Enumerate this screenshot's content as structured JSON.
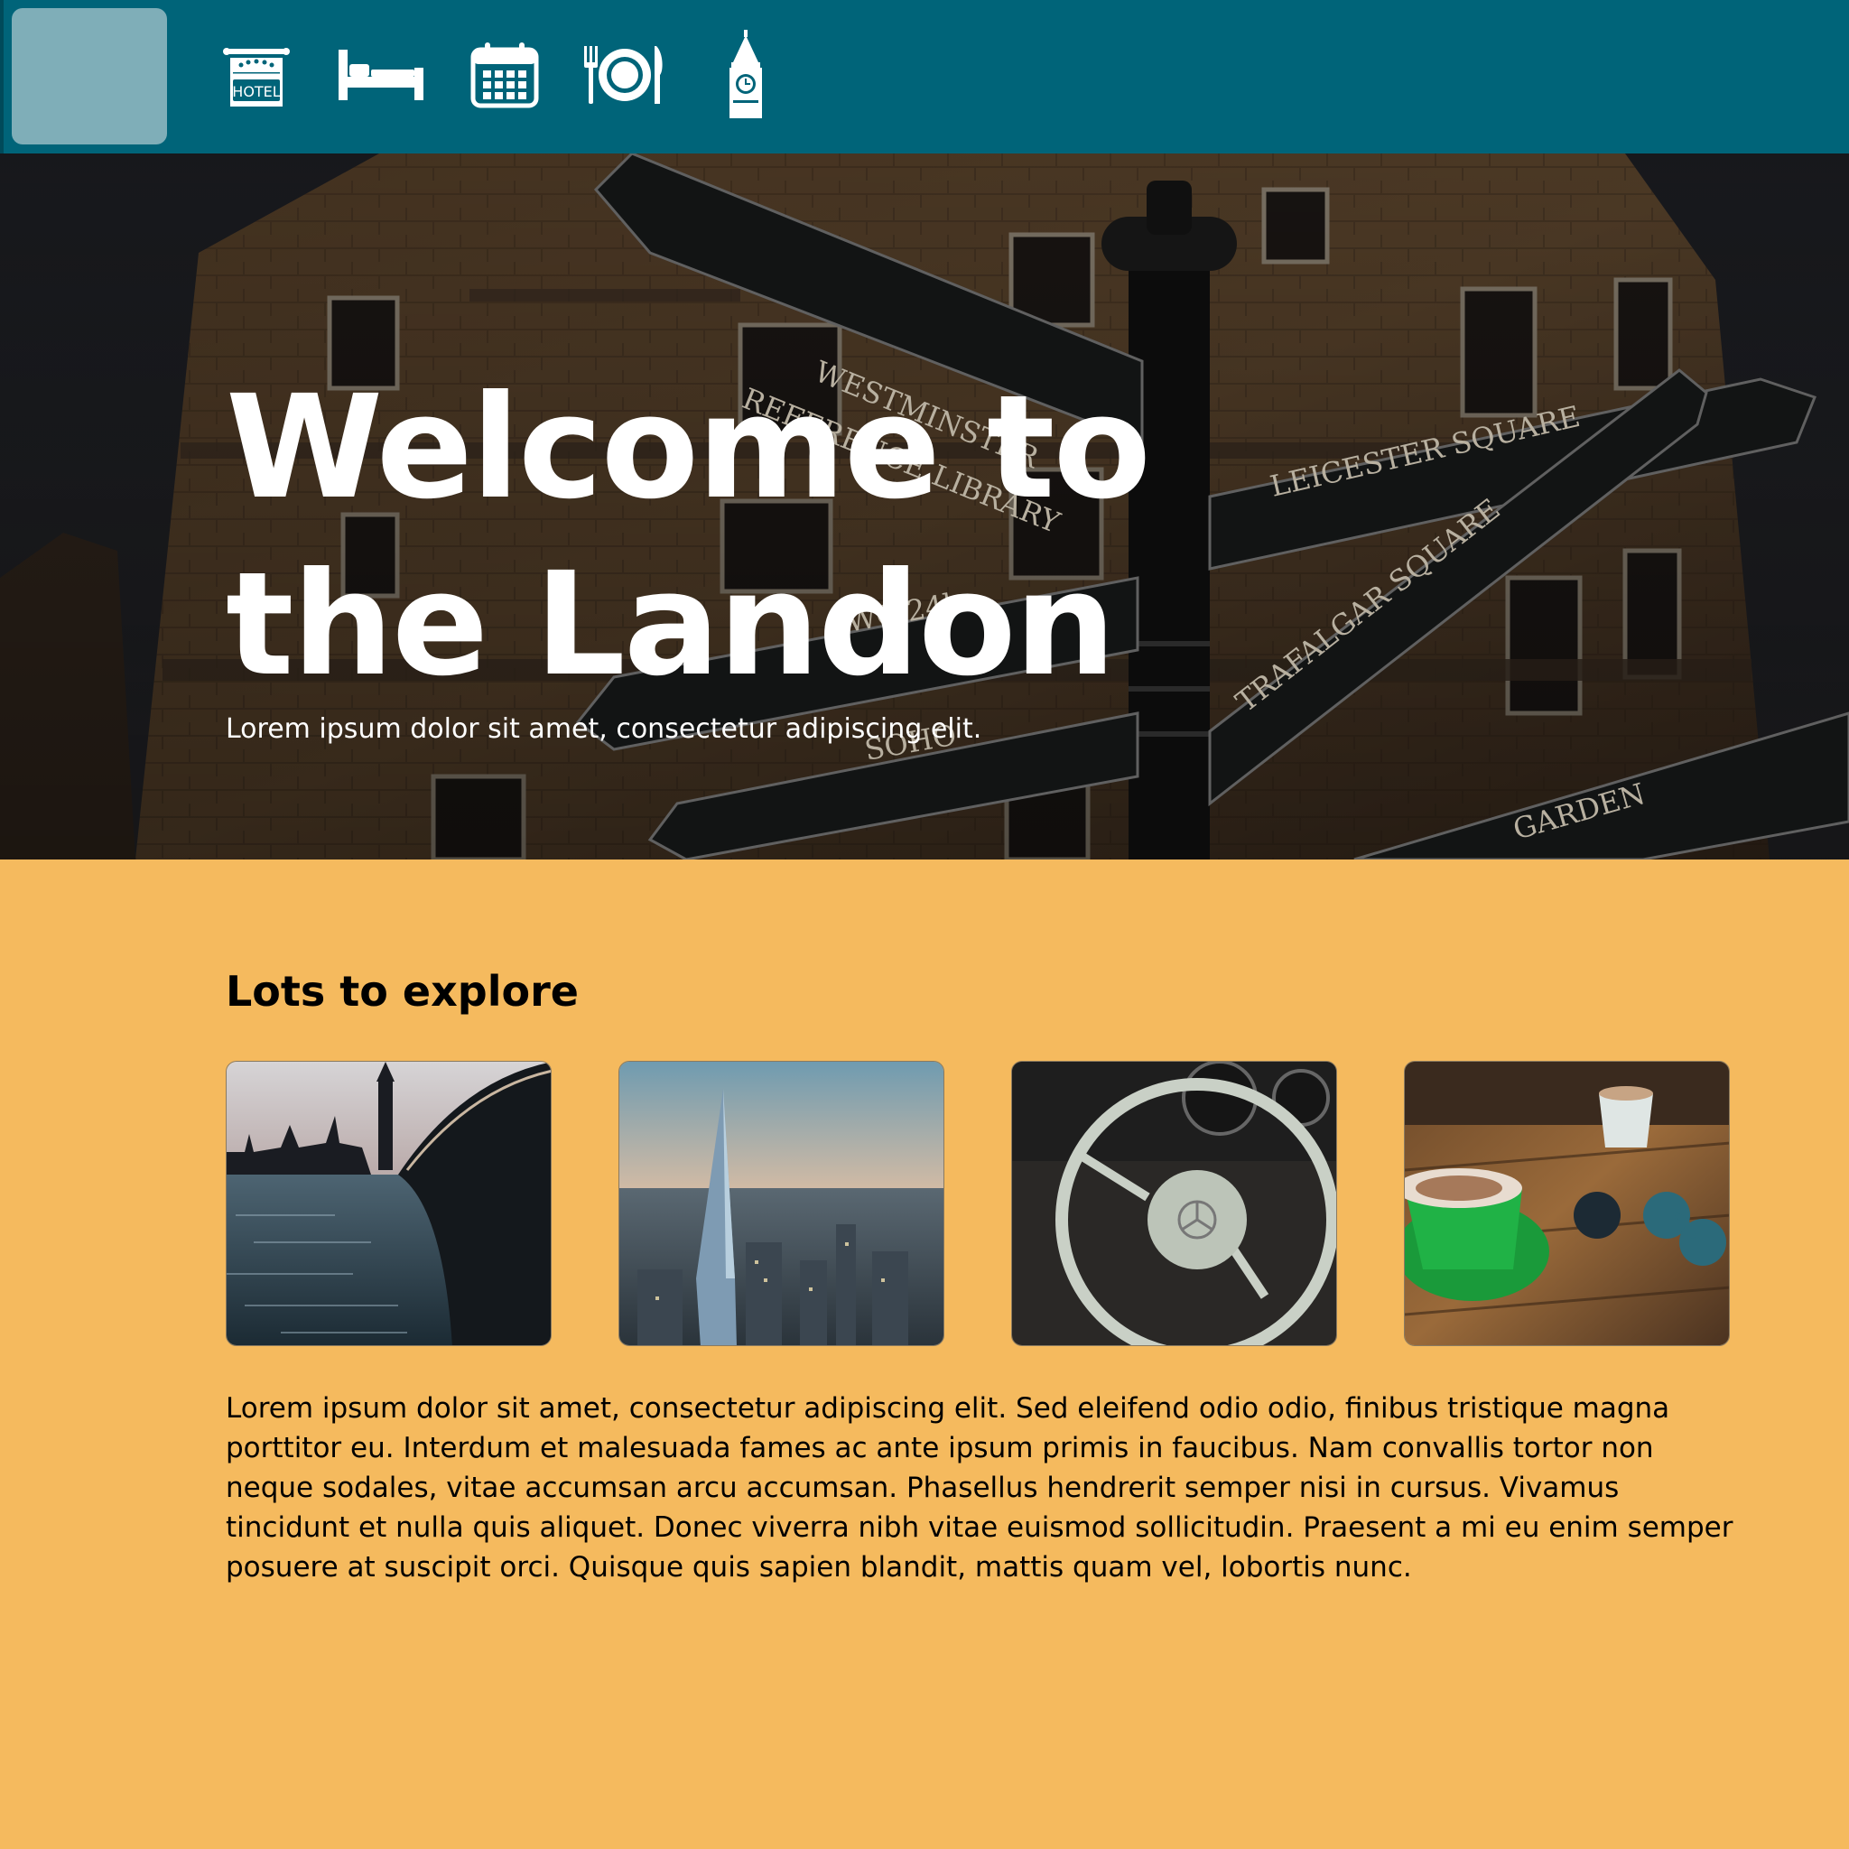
{
  "nav": {
    "icons": [
      "hotel-icon",
      "bed-icon",
      "calendar-icon",
      "dining-icon",
      "big-ben-icon"
    ],
    "hotel_icon_label": "HOTEL"
  },
  "hero": {
    "title": "Welcome to the Landon",
    "subtitle": "Lorem ipsum dolor sit amet, consectetur adipiscing elit.",
    "signs": [
      "WESTMINSTER",
      "REFERENCE LIBRARY",
      "LEICESTER SQUARE",
      "TRAFALGAR SQUARE",
      "WC 24hr",
      "SOHO",
      "GARDEN"
    ]
  },
  "explore": {
    "heading": "Lots to explore",
    "images": [
      "westminster-thames-photo",
      "shard-skyline-photo",
      "vintage-steering-wheel-photo",
      "coffee-table-photo"
    ],
    "body": "Lorem ipsum dolor sit amet, consectetur adipiscing elit. Sed eleifend odio odio, finibus tristique magna porttitor eu. Interdum et malesuada fames ac ante ipsum primis in faucibus. Nam convallis tortor non neque sodales, vitae accumsan arcu accumsan. Phasellus hendrerit semper nisi in cursus. Vivamus tincidunt et nulla quis aliquet. Donec viverra nibh vitae euismod sollicitudin. Praesent a mi eu enim semper posuere at suscipit orci. Quisque quis sapien blandit, mattis quam vel, lobortis nunc."
  },
  "colors": {
    "navbar": "#006479",
    "toggle": "#7FAEB8",
    "page_background": "#F5BA5E"
  }
}
